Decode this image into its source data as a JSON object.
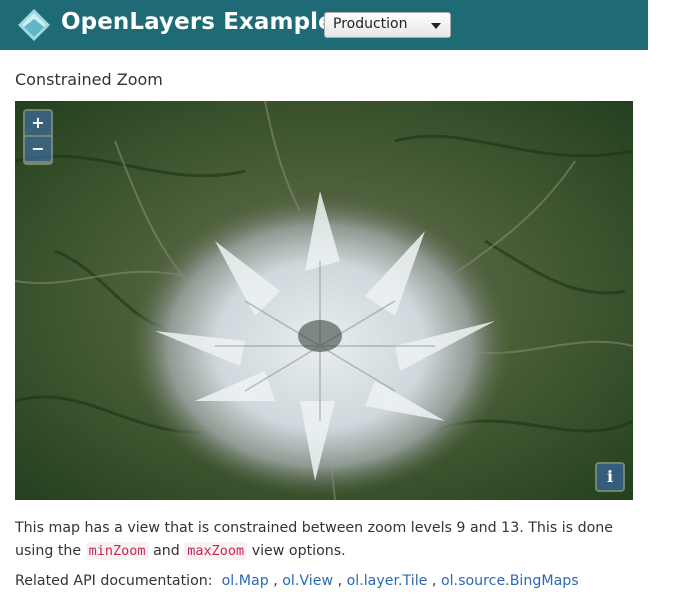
{
  "header": {
    "brand": "OpenLayers Examples",
    "version_select": {
      "selected": "Production"
    },
    "bg_color": "#1f6b75"
  },
  "page": {
    "title": "Constrained Zoom"
  },
  "map": {
    "zoom_in_label": "+",
    "zoom_out_label": "−",
    "attribution_label": "i"
  },
  "description": {
    "part1": "This map has a view that is constrained between zoom levels 9 and 13. This is done using the",
    "code1": "minZoom",
    "part2": "and",
    "code2": "maxZoom",
    "part3": "view options."
  },
  "related": {
    "label": "Related API documentation:",
    "links": [
      "ol.Map",
      "ol.View",
      "ol.layer.Tile",
      "ol.source.BingMaps"
    ],
    "separator": ","
  }
}
